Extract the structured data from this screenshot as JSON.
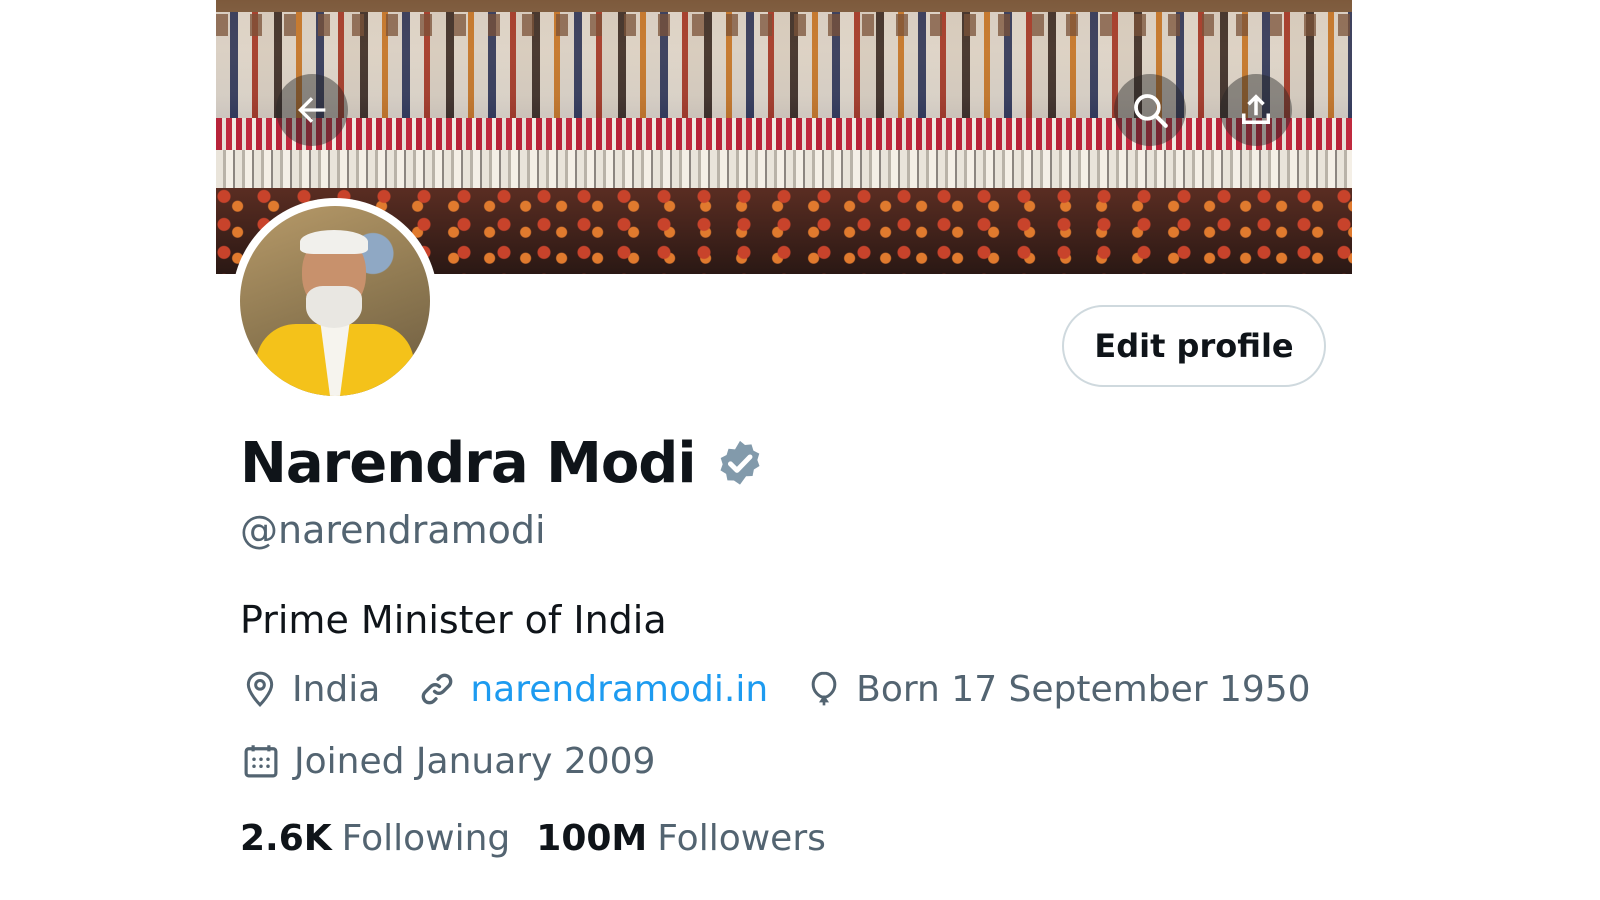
{
  "header": {
    "back_icon": "arrow-left-icon",
    "search_icon": "search-icon",
    "share_icon": "share-upload-icon"
  },
  "profile": {
    "name": "Narendra Modi",
    "verified_icon": "verified-badge-icon",
    "verified_color": "#829aab",
    "handle": "@narendramodi",
    "bio": "Prime Minister of India",
    "location": "India",
    "website": "narendramodi.in",
    "birthday": "Born 17 September 1950",
    "joined": "Joined January 2009",
    "link_color": "#1d9bf0"
  },
  "actions": {
    "edit_profile_label": "Edit profile"
  },
  "stats": {
    "following_count": "2.6K",
    "following_label": "Following",
    "followers_count": "100M",
    "followers_label": "Followers"
  }
}
